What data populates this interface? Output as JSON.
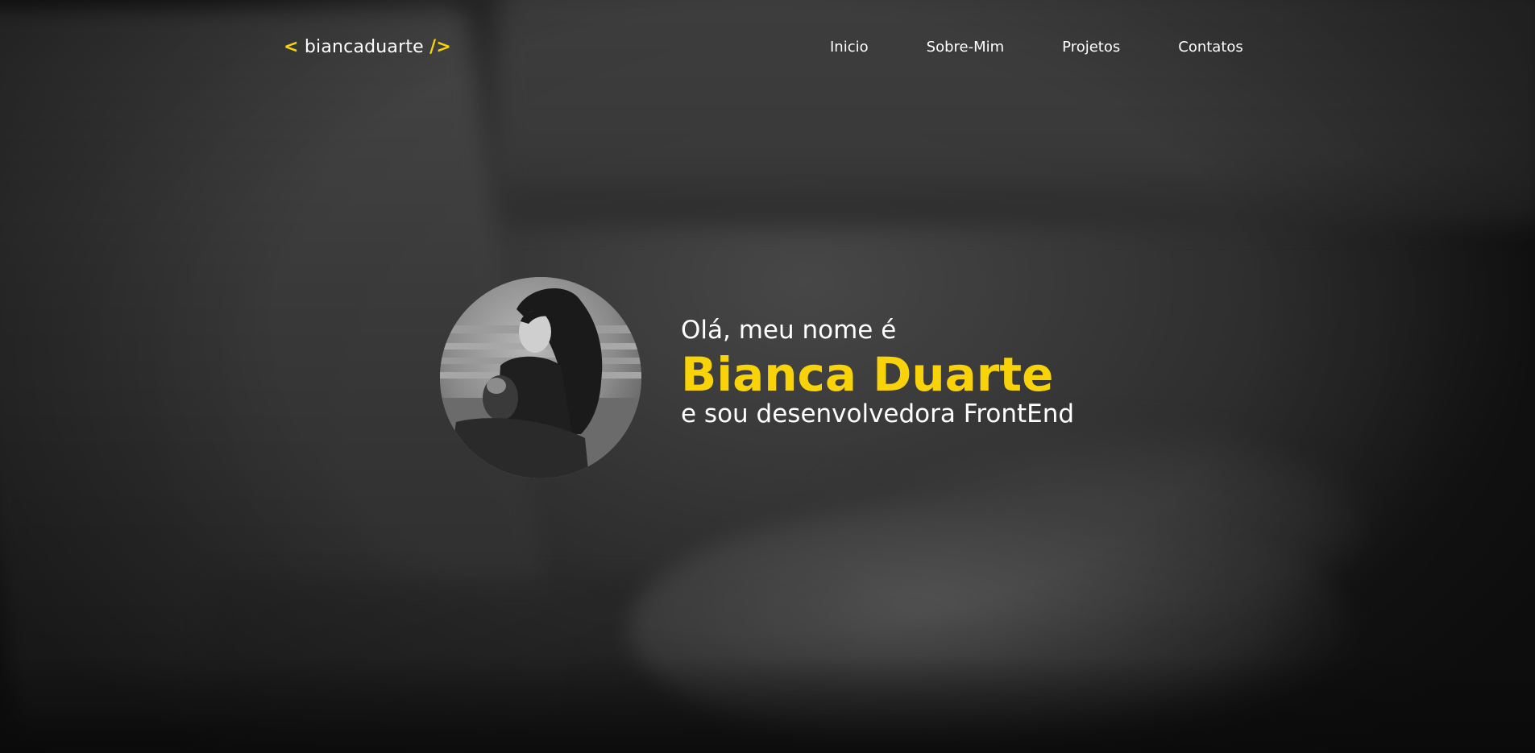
{
  "header": {
    "logo": {
      "open_tag": "<",
      "name": "biancaduarte",
      "close_tag": "/>"
    },
    "nav": [
      "Inicio",
      "Sobre-Mim",
      "Projetos",
      "Contatos"
    ]
  },
  "intro": {
    "greeting": "Olá, meu nome é",
    "name": "Bianca Duarte",
    "role": "e sou desenvolvedora FrontEnd"
  },
  "colors": {
    "accent": "#f9d30a",
    "text": "#ffffff",
    "background": "#2b2b2b"
  },
  "icons": {
    "avatar": "profile-photo"
  }
}
